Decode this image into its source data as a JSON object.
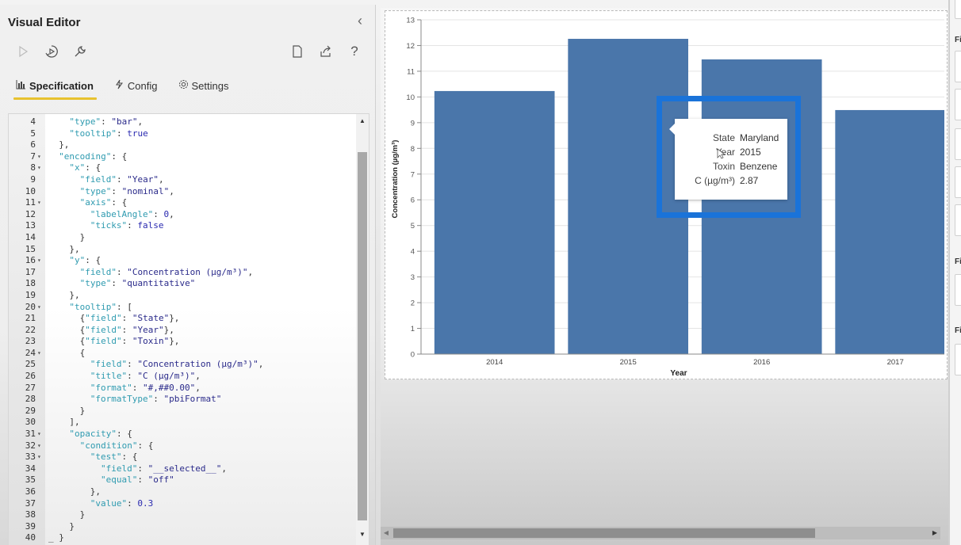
{
  "panel": {
    "title": "Visual Editor",
    "collapse_icon": "chevron-left-icon",
    "toolbar_left": [
      {
        "name": "run-icon",
        "label": "Run"
      },
      {
        "name": "auto-apply-icon",
        "label": "Auto apply"
      },
      {
        "name": "repair-icon",
        "label": "Repair and format"
      }
    ],
    "toolbar_right": [
      {
        "name": "new-spec-icon",
        "label": "New"
      },
      {
        "name": "export-icon",
        "label": "Export"
      },
      {
        "name": "help-icon",
        "label": "Help"
      }
    ],
    "tabs": [
      {
        "label": "Specification",
        "icon": "bar-chart-icon",
        "active": true
      },
      {
        "label": "Config",
        "icon": "config-icon",
        "active": false
      },
      {
        "label": "Settings",
        "icon": "gear-icon",
        "active": false
      }
    ]
  },
  "editor": {
    "lines": [
      {
        "n": "4",
        "fold": false,
        "indent": 2,
        "tokens": [
          [
            "k",
            "\"type\""
          ],
          [
            "p",
            ": "
          ],
          [
            "s",
            "\"bar\""
          ],
          [
            "p",
            ","
          ]
        ]
      },
      {
        "n": "5",
        "fold": false,
        "indent": 2,
        "tokens": [
          [
            "k",
            "\"tooltip\""
          ],
          [
            "p",
            ": "
          ],
          [
            "n",
            "true"
          ]
        ]
      },
      {
        "n": "6",
        "fold": false,
        "indent": 1,
        "tokens": [
          [
            "p",
            "},"
          ]
        ]
      },
      {
        "n": "7",
        "fold": true,
        "indent": 1,
        "tokens": [
          [
            "k",
            "\"encoding\""
          ],
          [
            "p",
            ": {"
          ]
        ]
      },
      {
        "n": "8",
        "fold": true,
        "indent": 2,
        "tokens": [
          [
            "k",
            "\"x\""
          ],
          [
            "p",
            ": {"
          ]
        ]
      },
      {
        "n": "9",
        "fold": false,
        "indent": 3,
        "tokens": [
          [
            "k",
            "\"field\""
          ],
          [
            "p",
            ": "
          ],
          [
            "s",
            "\"Year\""
          ],
          [
            "p",
            ","
          ]
        ]
      },
      {
        "n": "10",
        "fold": false,
        "indent": 3,
        "tokens": [
          [
            "k",
            "\"type\""
          ],
          [
            "p",
            ": "
          ],
          [
            "s",
            "\"nominal\""
          ],
          [
            "p",
            ","
          ]
        ]
      },
      {
        "n": "11",
        "fold": true,
        "indent": 3,
        "tokens": [
          [
            "k",
            "\"axis\""
          ],
          [
            "p",
            ": {"
          ]
        ]
      },
      {
        "n": "12",
        "fold": false,
        "indent": 4,
        "tokens": [
          [
            "k",
            "\"labelAngle\""
          ],
          [
            "p",
            ": "
          ],
          [
            "n",
            "0"
          ],
          [
            "p",
            ","
          ]
        ]
      },
      {
        "n": "13",
        "fold": false,
        "indent": 4,
        "tokens": [
          [
            "k",
            "\"ticks\""
          ],
          [
            "p",
            ": "
          ],
          [
            "n",
            "false"
          ]
        ]
      },
      {
        "n": "14",
        "fold": false,
        "indent": 3,
        "tokens": [
          [
            "p",
            "}"
          ]
        ]
      },
      {
        "n": "15",
        "fold": false,
        "indent": 2,
        "tokens": [
          [
            "p",
            "},"
          ]
        ]
      },
      {
        "n": "16",
        "fold": true,
        "indent": 2,
        "tokens": [
          [
            "k",
            "\"y\""
          ],
          [
            "p",
            ": {"
          ]
        ]
      },
      {
        "n": "17",
        "fold": false,
        "indent": 3,
        "tokens": [
          [
            "k",
            "\"field\""
          ],
          [
            "p",
            ": "
          ],
          [
            "s",
            "\"Concentration (µg/m³)\""
          ],
          [
            "p",
            ","
          ]
        ]
      },
      {
        "n": "18",
        "fold": false,
        "indent": 3,
        "tokens": [
          [
            "k",
            "\"type\""
          ],
          [
            "p",
            ": "
          ],
          [
            "s",
            "\"quantitative\""
          ]
        ]
      },
      {
        "n": "19",
        "fold": false,
        "indent": 2,
        "tokens": [
          [
            "p",
            "},"
          ]
        ]
      },
      {
        "n": "20",
        "fold": true,
        "indent": 2,
        "tokens": [
          [
            "k",
            "\"tooltip\""
          ],
          [
            "p",
            ": ["
          ]
        ]
      },
      {
        "n": "21",
        "fold": false,
        "indent": 3,
        "tokens": [
          [
            "p",
            "{"
          ],
          [
            "k",
            "\"field\""
          ],
          [
            "p",
            ": "
          ],
          [
            "s",
            "\"State\""
          ],
          [
            "p",
            "},"
          ]
        ]
      },
      {
        "n": "22",
        "fold": false,
        "indent": 3,
        "tokens": [
          [
            "p",
            "{"
          ],
          [
            "k",
            "\"field\""
          ],
          [
            "p",
            ": "
          ],
          [
            "s",
            "\"Year\""
          ],
          [
            "p",
            "},"
          ]
        ]
      },
      {
        "n": "23",
        "fold": false,
        "indent": 3,
        "tokens": [
          [
            "p",
            "{"
          ],
          [
            "k",
            "\"field\""
          ],
          [
            "p",
            ": "
          ],
          [
            "s",
            "\"Toxin\""
          ],
          [
            "p",
            "},"
          ]
        ]
      },
      {
        "n": "24",
        "fold": true,
        "indent": 3,
        "tokens": [
          [
            "p",
            "{"
          ]
        ]
      },
      {
        "n": "25",
        "fold": false,
        "indent": 4,
        "tokens": [
          [
            "k",
            "\"field\""
          ],
          [
            "p",
            ": "
          ],
          [
            "s",
            "\"Concentration (µg/m³)\""
          ],
          [
            "p",
            ","
          ]
        ]
      },
      {
        "n": "26",
        "fold": false,
        "indent": 4,
        "tokens": [
          [
            "k",
            "\"title\""
          ],
          [
            "p",
            ": "
          ],
          [
            "s",
            "\"C (µg/m³)\""
          ],
          [
            "p",
            ","
          ]
        ]
      },
      {
        "n": "27",
        "fold": false,
        "indent": 4,
        "tokens": [
          [
            "k",
            "\"format\""
          ],
          [
            "p",
            ": "
          ],
          [
            "s",
            "\"#,##0.00\""
          ],
          [
            "p",
            ","
          ]
        ]
      },
      {
        "n": "28",
        "fold": false,
        "indent": 4,
        "tokens": [
          [
            "k",
            "\"formatType\""
          ],
          [
            "p",
            ": "
          ],
          [
            "s",
            "\"pbiFormat\""
          ]
        ]
      },
      {
        "n": "29",
        "fold": false,
        "indent": 3,
        "tokens": [
          [
            "p",
            "}"
          ]
        ]
      },
      {
        "n": "30",
        "fold": false,
        "indent": 2,
        "tokens": [
          [
            "p",
            "],"
          ]
        ]
      },
      {
        "n": "31",
        "fold": true,
        "indent": 2,
        "tokens": [
          [
            "k",
            "\"opacity\""
          ],
          [
            "p",
            ": {"
          ]
        ]
      },
      {
        "n": "32",
        "fold": true,
        "indent": 3,
        "tokens": [
          [
            "k",
            "\"condition\""
          ],
          [
            "p",
            ": {"
          ]
        ]
      },
      {
        "n": "33",
        "fold": true,
        "indent": 4,
        "tokens": [
          [
            "k",
            "\"test\""
          ],
          [
            "p",
            ": {"
          ]
        ]
      },
      {
        "n": "34",
        "fold": false,
        "indent": 5,
        "tokens": [
          [
            "k",
            "\"field\""
          ],
          [
            "p",
            ": "
          ],
          [
            "s",
            "\"__selected__\""
          ],
          [
            "p",
            ","
          ]
        ]
      },
      {
        "n": "35",
        "fold": false,
        "indent": 5,
        "tokens": [
          [
            "k",
            "\"equal\""
          ],
          [
            "p",
            ": "
          ],
          [
            "s",
            "\"off\""
          ]
        ]
      },
      {
        "n": "36",
        "fold": false,
        "indent": 4,
        "tokens": [
          [
            "p",
            "},"
          ]
        ]
      },
      {
        "n": "37",
        "fold": false,
        "indent": 4,
        "tokens": [
          [
            "k",
            "\"value\""
          ],
          [
            "p",
            ": "
          ],
          [
            "n",
            "0.3"
          ]
        ]
      },
      {
        "n": "38",
        "fold": false,
        "indent": 3,
        "tokens": [
          [
            "p",
            "}"
          ]
        ]
      },
      {
        "n": "39",
        "fold": false,
        "indent": 2,
        "tokens": [
          [
            "p",
            "}"
          ]
        ]
      },
      {
        "n": "40",
        "fold": false,
        "indent": 0,
        "tokens": [
          [
            "p",
            "_ }"
          ]
        ]
      }
    ]
  },
  "tooltip": {
    "rows": [
      {
        "label": "State",
        "value": "Maryland"
      },
      {
        "label": "Year",
        "value": "2015"
      },
      {
        "label": "Toxin",
        "value": "Benzene"
      },
      {
        "label": "C (µg/m³)",
        "value": "2.87"
      }
    ]
  },
  "right_pane": {
    "labels": [
      "Fi",
      "Fi",
      "Fi"
    ]
  },
  "colors": {
    "bar": "#4a76aa",
    "highlight": "#1a73d9",
    "tab_underline": "#e8c22f"
  },
  "chart_data": {
    "type": "bar",
    "stacked": true,
    "title": "",
    "xlabel": "Year",
    "ylabel": "Concentration (µg/m³)",
    "categories": [
      "2014",
      "2015",
      "2016",
      "2017"
    ],
    "values": [
      10.23,
      12.26,
      11.46,
      9.49
    ],
    "ylim": [
      0,
      13
    ],
    "yticks": [
      0,
      1,
      2,
      3,
      4,
      5,
      6,
      7,
      8,
      9,
      10,
      11,
      12,
      13
    ],
    "grid": true,
    "legend": "none"
  }
}
